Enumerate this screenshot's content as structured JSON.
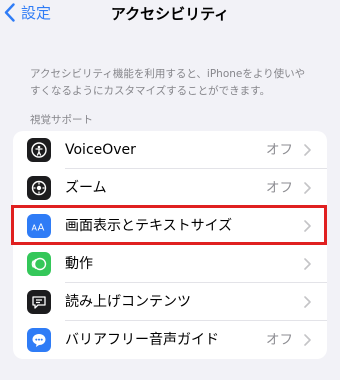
{
  "nav": {
    "back_label": "設定",
    "title": "アクセシビリティ"
  },
  "description": {
    "line1": "アクセシビリティ機能を利用すると、iPhoneをより使いや",
    "line2": "すくなるようにカスタマイズすることができます。"
  },
  "section": {
    "header": "視覚サポート"
  },
  "rows": [
    {
      "label": "VoiceOver",
      "value": "オフ",
      "icon": "voiceover-icon",
      "icon_color": "#1c1c1e"
    },
    {
      "label": "ズーム",
      "value": "オフ",
      "icon": "zoom-icon",
      "icon_color": "#1c1c1e"
    },
    {
      "label": "画面表示とテキストサイズ",
      "value": "",
      "icon": "display-text-size-icon",
      "icon_color": "#2f7cf6"
    },
    {
      "label": "動作",
      "value": "",
      "icon": "motion-icon",
      "icon_color": "#34c759"
    },
    {
      "label": "読み上げコンテンツ",
      "value": "",
      "icon": "spoken-content-icon",
      "icon_color": "#1c1c1e"
    },
    {
      "label": "バリアフリー音声ガイド",
      "value": "オフ",
      "icon": "audio-descriptions-icon",
      "icon_color": "#2f7cf6"
    }
  ],
  "colors": {
    "accent": "#2f7cf6",
    "highlight": "#e02020",
    "background": "#f2f2f7"
  }
}
